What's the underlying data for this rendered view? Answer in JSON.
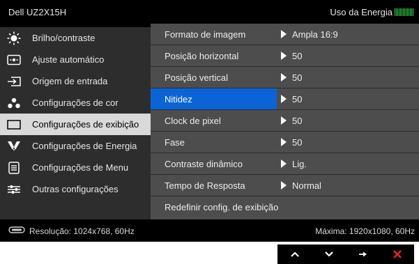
{
  "header": {
    "model": "Dell UZ2X15H",
    "energy_label": "Uso da Energia",
    "energy_level": 1.0
  },
  "menu": [
    {
      "label": "Brilho/contraste",
      "icon": "sun-icon"
    },
    {
      "label": "Ajuste automático",
      "icon": "auto-adjust-icon"
    },
    {
      "label": "Origem de entrada",
      "icon": "input-source-icon"
    },
    {
      "label": "Configurações de cor",
      "icon": "color-dots-icon"
    },
    {
      "label": "Configurações de exibição",
      "icon": "display-rect-icon",
      "selected": true
    },
    {
      "label": "Configurações de Energia",
      "icon": "energy-icon"
    },
    {
      "label": "Configurações de Menu",
      "icon": "menu-doc-icon"
    },
    {
      "label": "Outras configurações",
      "icon": "sliders-icon"
    }
  ],
  "settings": [
    {
      "name": "Formato de imagem",
      "value": "Ampla 16:9"
    },
    {
      "name": "Posição horizontal",
      "value": "50"
    },
    {
      "name": "Posição vertical",
      "value": "50"
    },
    {
      "name": "Nitidez",
      "value": "50",
      "active": true
    },
    {
      "name": "Clock de pixel",
      "value": "50"
    },
    {
      "name": "Fase",
      "value": "50"
    },
    {
      "name": "Contraste dinâmico",
      "value": "Lig."
    },
    {
      "name": "Tempo de Resposta",
      "value": "Normal"
    },
    {
      "name": "Redefinir config. de exibição",
      "value": ""
    }
  ],
  "footer": {
    "resolution": "Resolução: 1024x768, 60Hz",
    "max": "Máxima: 1920x1080, 60Hz"
  },
  "nav": [
    "up-arrow-icon",
    "down-arrow-icon",
    "right-arrow-icon",
    "close-x-icon"
  ],
  "colors": {
    "accent": "#0a64d8",
    "energy": "#39d64a",
    "close": "#e62020"
  }
}
